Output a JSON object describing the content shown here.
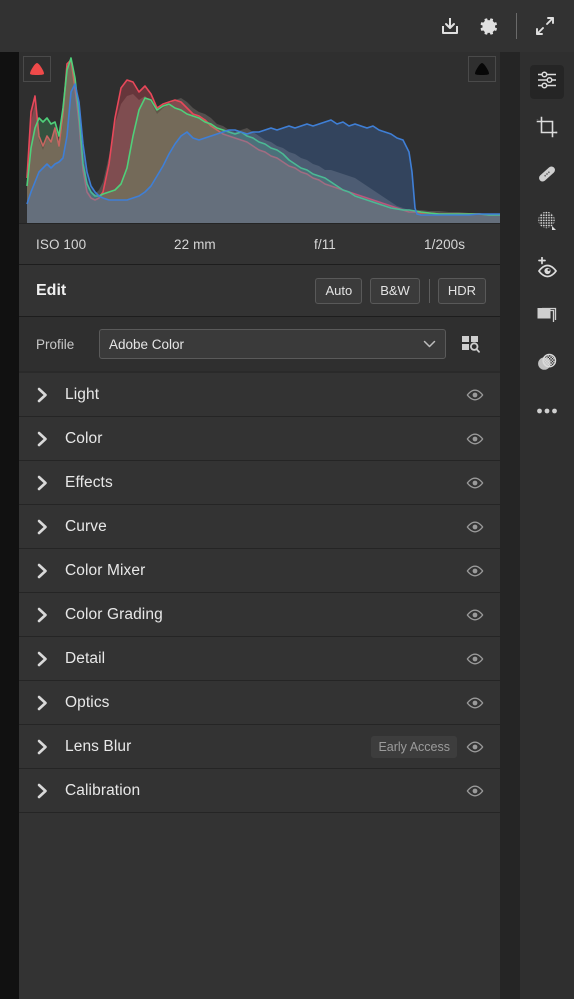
{
  "colors": {
    "app_bg": "#111111",
    "panel_bg": "#2f2f2f",
    "row_bg": "#333333",
    "topbar_bg": "#323232",
    "text": "#e8e8e8",
    "muted_text": "#9c9c9c",
    "histogram_red": "#e8485a",
    "histogram_green": "#4fd07a",
    "histogram_blue": "#3f7fd6",
    "clip_shadow_active": "#f04a4a",
    "clip_highlight_inactive": "#050505"
  },
  "topbar": {
    "icons": [
      {
        "name": "import-icon",
        "title": "Import"
      },
      {
        "name": "gear-icon",
        "title": "Settings"
      },
      {
        "name": "expand-icon",
        "title": "Full Screen"
      }
    ]
  },
  "histogram": {
    "shadow_clip_label": "Shadow Clipping",
    "highlight_clip_label": "Highlight Clipping",
    "exif": [
      "ISO 100",
      "22 mm",
      "f/11",
      "1/200s"
    ]
  },
  "edit": {
    "title": "Edit",
    "buttons": [
      "Auto",
      "B&W"
    ],
    "hdr_button": "HDR"
  },
  "profile": {
    "label": "Profile",
    "value": "Adobe Color",
    "browse_title": "Browse Profiles"
  },
  "panels": [
    {
      "name": "Light",
      "badge": ""
    },
    {
      "name": "Color",
      "badge": ""
    },
    {
      "name": "Effects",
      "badge": ""
    },
    {
      "name": "Curve",
      "badge": ""
    },
    {
      "name": "Color Mixer",
      "badge": ""
    },
    {
      "name": "Color Grading",
      "badge": ""
    },
    {
      "name": "Detail",
      "badge": ""
    },
    {
      "name": "Optics",
      "badge": ""
    },
    {
      "name": "Lens Blur",
      "badge": "Early Access"
    },
    {
      "name": "Calibration",
      "badge": ""
    }
  ],
  "rail": [
    {
      "name": "edit-sliders-icon",
      "title": "Edit",
      "active": true
    },
    {
      "name": "crop-icon",
      "title": "Crop & Rotate",
      "active": false
    },
    {
      "name": "healing-brush-icon",
      "title": "Remove",
      "active": false
    },
    {
      "name": "masking-icon",
      "title": "Masking",
      "active": false
    },
    {
      "name": "red-eye-icon",
      "title": "Red Eye",
      "active": false
    },
    {
      "name": "versions-icon",
      "title": "Versions",
      "active": false
    },
    {
      "name": "presets-icon",
      "title": "Presets",
      "active": false
    },
    {
      "name": "more-options-icon",
      "title": "More",
      "active": false
    }
  ]
}
